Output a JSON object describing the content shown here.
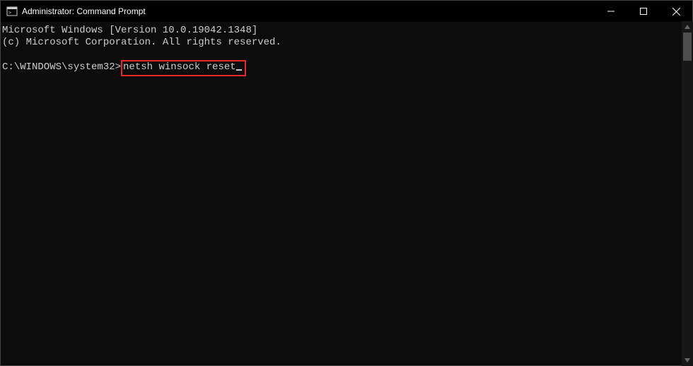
{
  "titlebar": {
    "title": "Administrator: Command Prompt"
  },
  "terminal": {
    "line1": "Microsoft Windows [Version 10.0.19042.1348]",
    "line2": "(c) Microsoft Corporation. All rights reserved.",
    "blank": "",
    "prompt": "C:\\WINDOWS\\system32>",
    "command": "netsh winsock reset"
  }
}
